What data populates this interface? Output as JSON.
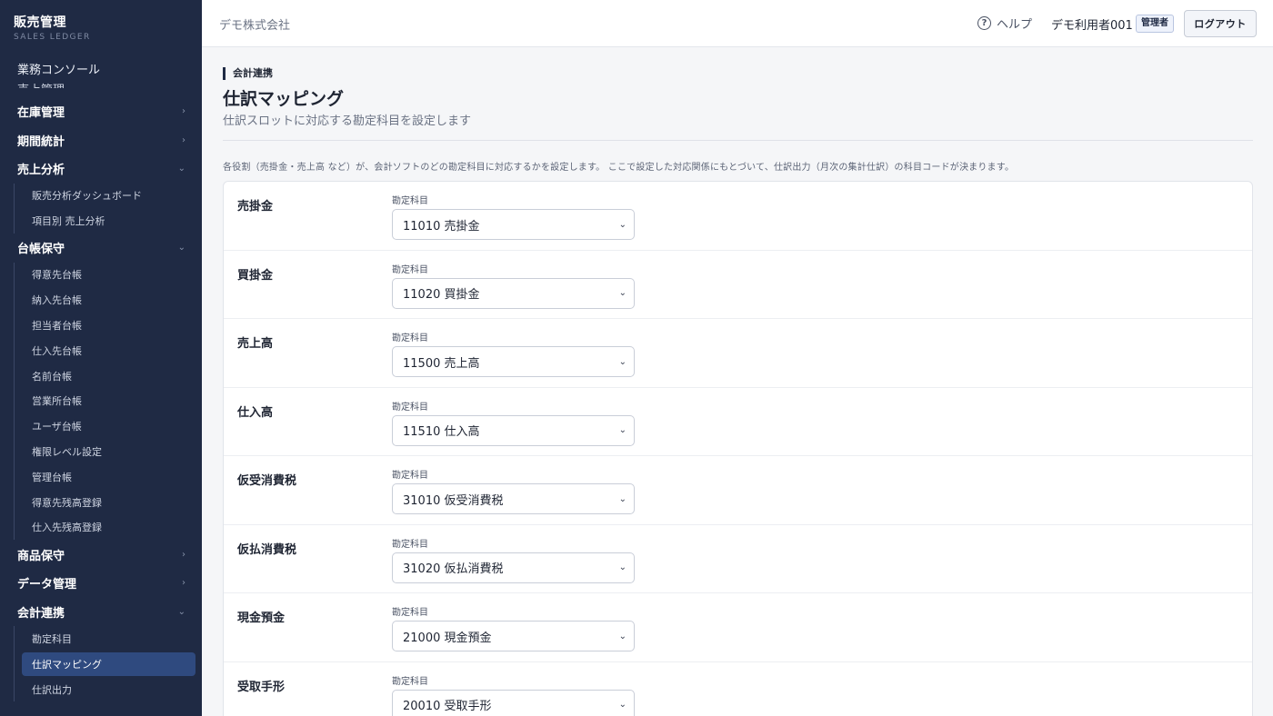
{
  "brand": {
    "title": "販売管理",
    "subtitle": "SALES LEDGER"
  },
  "sidebar": {
    "console": "業務コンソール",
    "clipped_item": "売上管理",
    "groups": [
      {
        "label": "在庫管理",
        "state": "collapsed",
        "chevron": "›"
      },
      {
        "label": "期間統計",
        "state": "collapsed",
        "chevron": "›"
      },
      {
        "label": "売上分析",
        "state": "expanded",
        "chevron": "⌄",
        "items": [
          "販売分析ダッシュボード",
          "項目別 売上分析"
        ]
      },
      {
        "label": "台帳保守",
        "state": "expanded",
        "chevron": "⌄",
        "items": [
          "得意先台帳",
          "納入先台帳",
          "担当者台帳",
          "仕入先台帳",
          "名前台帳",
          "営業所台帳",
          "ユーザ台帳",
          "権限レベル設定",
          "管理台帳",
          "得意先残高登録",
          "仕入先残高登録"
        ]
      },
      {
        "label": "商品保守",
        "state": "collapsed",
        "chevron": "›"
      },
      {
        "label": "データ管理",
        "state": "collapsed",
        "chevron": "›"
      },
      {
        "label": "会計連携",
        "state": "expanded",
        "chevron": "⌄",
        "items": [
          "勘定科目",
          "仕訳マッピング",
          "仕訳出力"
        ],
        "active_item": "仕訳マッピング"
      }
    ]
  },
  "header": {
    "company": "デモ株式会社",
    "help": "ヘルプ",
    "help_icon": "?",
    "user": "デモ利用者001",
    "role": "管理者",
    "logout": "ログアウト"
  },
  "page": {
    "breadcrumb": "会計連携",
    "title": "仕訳マッピング",
    "subtitle": "仕訳スロットに対応する勘定科目を設定します",
    "description": "各役割（売掛金・売上高 など）が、会計ソフトのどの勘定科目に対応するかを設定します。 ここで設定した対応関係にもとづいて、仕訳出力（月次の集計仕訳）の科目コードが決まります。"
  },
  "mappings": [
    {
      "role": "売掛金",
      "field_label": "勘定科目",
      "value": "11010 売掛金"
    },
    {
      "role": "買掛金",
      "field_label": "勘定科目",
      "value": "11020 買掛金"
    },
    {
      "role": "売上高",
      "field_label": "勘定科目",
      "value": "11500 売上高"
    },
    {
      "role": "仕入高",
      "field_label": "勘定科目",
      "value": "11510 仕入高"
    },
    {
      "role": "仮受消費税",
      "field_label": "勘定科目",
      "value": "31010 仮受消費税"
    },
    {
      "role": "仮払消費税",
      "field_label": "勘定科目",
      "value": "31020 仮払消費税"
    },
    {
      "role": "現金預金",
      "field_label": "勘定科目",
      "value": "21000 現金預金"
    },
    {
      "role": "受取手形",
      "field_label": "勘定科目",
      "value": "20010 受取手形"
    }
  ],
  "select_caret": "⌄",
  "colors": {
    "sidebar_bg": "#1f2a44",
    "active_item_bg": "#2f4a7f",
    "page_bg": "#f5f6f8"
  }
}
